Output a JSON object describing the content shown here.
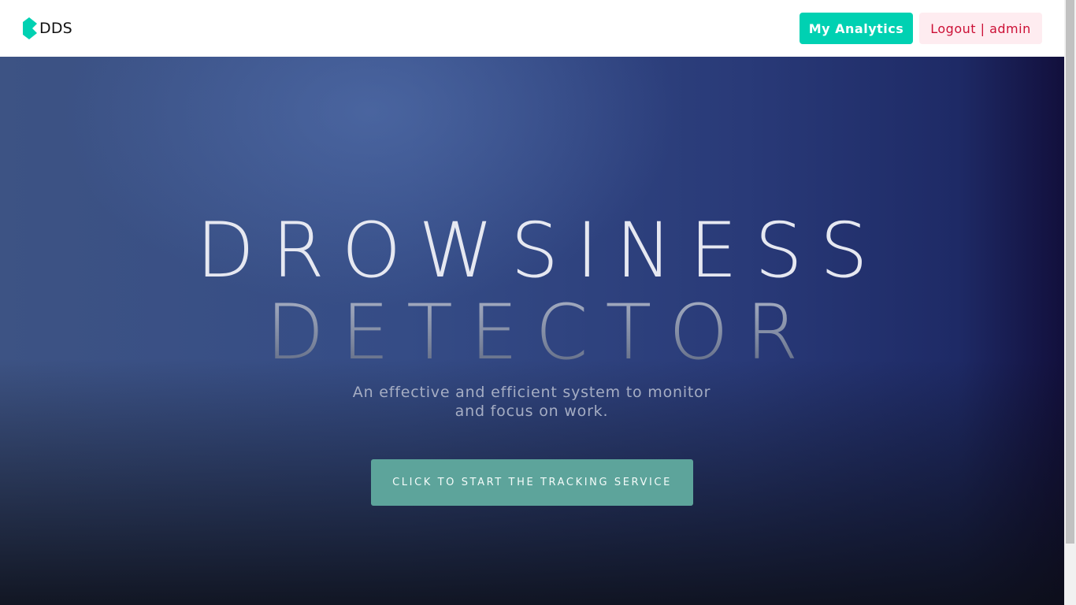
{
  "navbar": {
    "brand": "DDS",
    "analytics_label": "My Analytics",
    "logout_label": "Logout | admin"
  },
  "hero": {
    "title_line1": "DROWSINESS",
    "title_line2": "DETECTOR",
    "subtitle": "An effective and efficient system to monitor and focus on work.",
    "cta_label": "CLICK TO START THE TRACKING SERVICE"
  },
  "colors": {
    "accent": "#00d1b2",
    "logout_bg": "#feecf0",
    "logout_text": "#cc0f35",
    "cta_bg": "#5da49b",
    "hero_bg": "#354c86"
  },
  "icons": {
    "brand_logo": "dds-logo-icon"
  }
}
